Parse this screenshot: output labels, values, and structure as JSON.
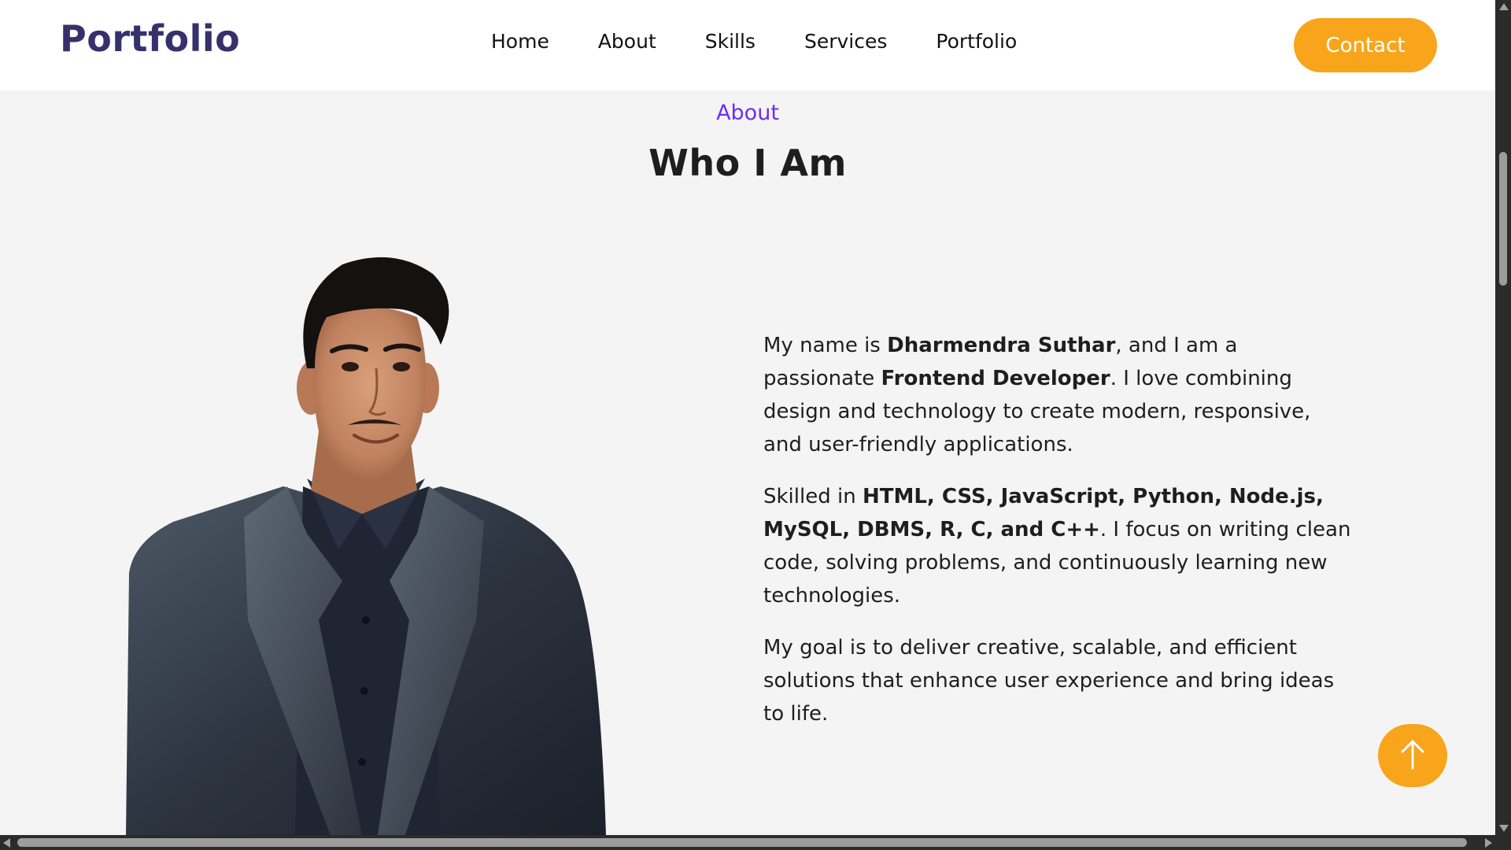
{
  "colors": {
    "brand": "#37306b",
    "accent": "#f8a51c",
    "kicker": "#6e2df5",
    "background": "#f4f4f4",
    "header": "#ffffff"
  },
  "header": {
    "logo": "Portfolio",
    "nav": [
      "Home",
      "About",
      "Skills",
      "Services",
      "Portfolio"
    ],
    "contact_label": "Contact"
  },
  "about": {
    "kicker": "About",
    "title": "Who I Am",
    "paragraphs": [
      [
        {
          "t": "My name is "
        },
        {
          "t": "Dharmendra Suthar",
          "b": true
        },
        {
          "t": ", and I am a passionate "
        },
        {
          "t": "Frontend Developer",
          "b": true
        },
        {
          "t": ". I love combining design and technology to create modern, responsive, and user-friendly applications."
        }
      ],
      [
        {
          "t": "Skilled in "
        },
        {
          "t": "HTML, CSS, JavaScript, Python, Node.js, MySQL, DBMS, R, C, and C++",
          "b": true
        },
        {
          "t": ". I focus on writing clean code, solving problems, and continuously learning new technologies."
        }
      ],
      [
        {
          "t": "My goal is to deliver creative, scalable, and efficient solutions that enhance user experience and bring ideas to life."
        }
      ]
    ]
  },
  "icons": {
    "back_to_top": "arrow-up-icon",
    "portrait": "profile-photo"
  }
}
